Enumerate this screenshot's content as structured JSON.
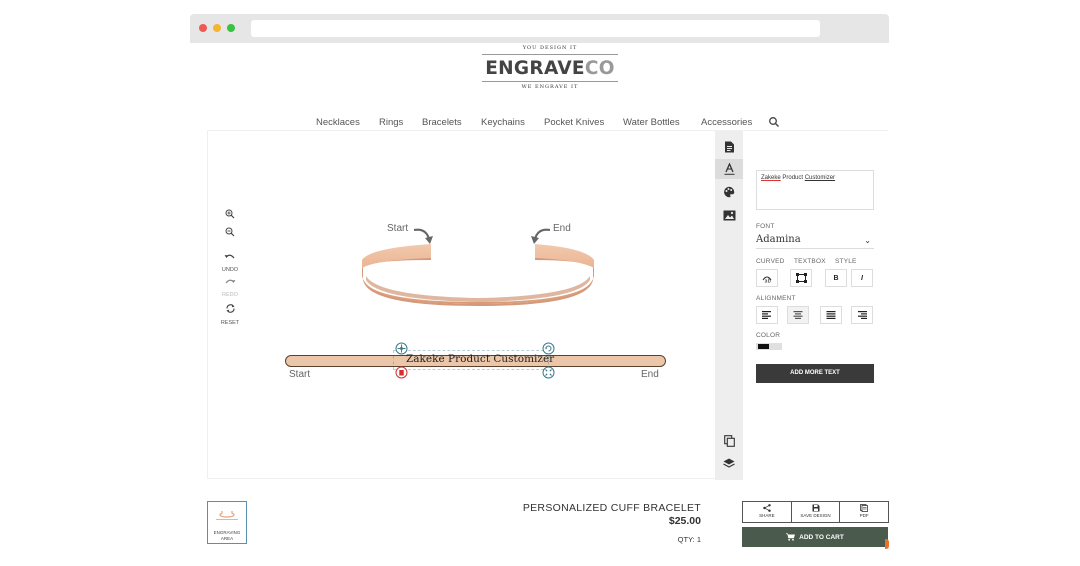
{
  "logo": {
    "tagline_top": "YOU DESIGN IT",
    "brand_main": "ENGRAVE",
    "brand_suffix": "CO",
    "tagline_bottom": "WE ENGRAVE IT"
  },
  "nav": {
    "items": [
      "Necklaces",
      "Rings",
      "Bracelets",
      "Keychains",
      "Pocket Knives",
      "Water Bottles",
      "Accessories"
    ],
    "search_icon": "search-icon"
  },
  "left_tools": {
    "zoom_in": "zoom-in-icon",
    "zoom_out": "zoom-out-icon",
    "undo_label": "UNDO",
    "redo_label": "REDO",
    "reset_label": "RESET"
  },
  "preview": {
    "start_label": "Start",
    "end_label": "End"
  },
  "engraving": {
    "text": "Zakeke Product Customizer",
    "start_label": "Start",
    "end_label": "End"
  },
  "panel": {
    "text_value_word1": "Zakeke",
    "text_value_word2": "Product",
    "text_value_word3": "Customizer",
    "font_label": "FONT",
    "font_value": "Adamina",
    "curved_label": "CURVED",
    "textbox_label": "TEXTBOX",
    "style_label": "STYLE",
    "bold_label": "B",
    "italic_label": "I",
    "alignment_label": "ALIGNMENT",
    "color_label": "COLOR",
    "color_value": "#111111",
    "add_text_label": "ADD MORE TEXT"
  },
  "thumbnail": {
    "label": "ENGRAVING AREA"
  },
  "product": {
    "name": "PERSONALIZED CUFF BRACELET",
    "price": "$25.00",
    "qty": "QTY: 1"
  },
  "actions": {
    "share": "SHARE",
    "save": "SAVE DESIGN",
    "pdf": "PDF",
    "cart": "ADD TO CART"
  },
  "colors": {
    "bracelet": "#e8b493",
    "cart_button": "#4a5a4d",
    "accent": "#e8742a",
    "handle_red": "#d32f2f",
    "handle_teal": "#3a7a8c"
  }
}
